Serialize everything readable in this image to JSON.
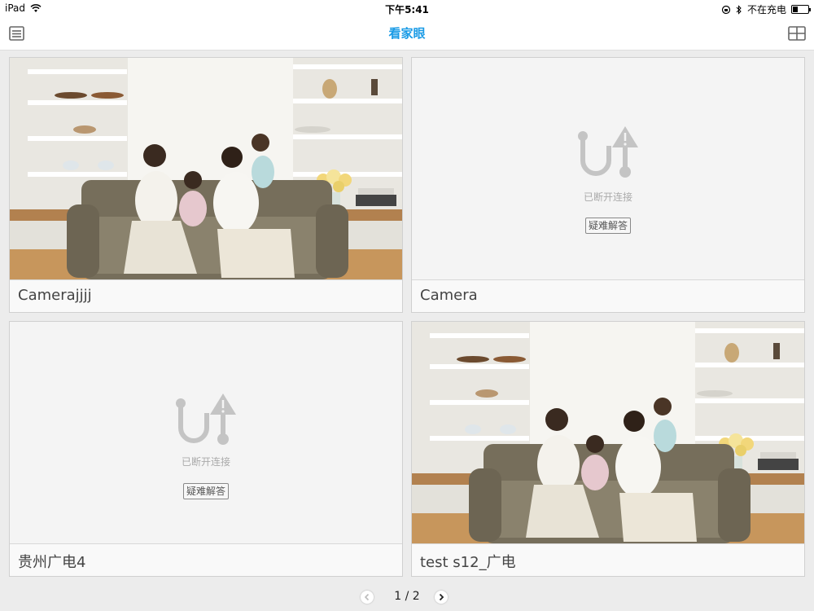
{
  "status_bar": {
    "device": "iPad",
    "time": "下午5:41",
    "charging_text": "不在充电"
  },
  "nav": {
    "title": "看家眼"
  },
  "cameras": [
    {
      "name": "Camerajjjj",
      "state": "online"
    },
    {
      "name": "Camera",
      "state": "offline",
      "offline_text": "已断开连接",
      "help_label": "疑难解答"
    },
    {
      "name": "贵州广电4",
      "state": "offline",
      "offline_text": "已断开连接",
      "help_label": "疑难解答"
    },
    {
      "name": "test s12_广电",
      "state": "online"
    }
  ],
  "pagination": {
    "text": "1 / 2"
  },
  "colors": {
    "accent": "#1a9be6",
    "card_bg": "#f4f4f4",
    "offline_icon": "#c4c4c4"
  },
  "icons": {
    "menu": "menu-icon",
    "grid": "grid-layout-icon",
    "offline": "disconnected-warning-icon"
  }
}
